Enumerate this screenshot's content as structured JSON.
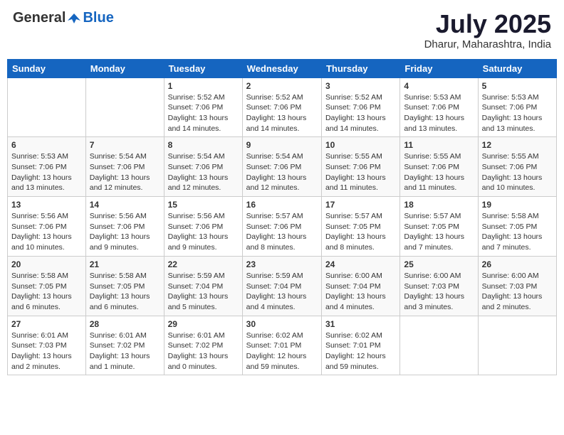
{
  "header": {
    "logo_general": "General",
    "logo_blue": "Blue",
    "month_title": "July 2025",
    "location": "Dharur, Maharashtra, India"
  },
  "days_of_week": [
    "Sunday",
    "Monday",
    "Tuesday",
    "Wednesday",
    "Thursday",
    "Friday",
    "Saturday"
  ],
  "weeks": [
    [
      {
        "day": "",
        "info": ""
      },
      {
        "day": "",
        "info": ""
      },
      {
        "day": "1",
        "info": "Sunrise: 5:52 AM\nSunset: 7:06 PM\nDaylight: 13 hours\nand 14 minutes."
      },
      {
        "day": "2",
        "info": "Sunrise: 5:52 AM\nSunset: 7:06 PM\nDaylight: 13 hours\nand 14 minutes."
      },
      {
        "day": "3",
        "info": "Sunrise: 5:52 AM\nSunset: 7:06 PM\nDaylight: 13 hours\nand 14 minutes."
      },
      {
        "day": "4",
        "info": "Sunrise: 5:53 AM\nSunset: 7:06 PM\nDaylight: 13 hours\nand 13 minutes."
      },
      {
        "day": "5",
        "info": "Sunrise: 5:53 AM\nSunset: 7:06 PM\nDaylight: 13 hours\nand 13 minutes."
      }
    ],
    [
      {
        "day": "6",
        "info": "Sunrise: 5:53 AM\nSunset: 7:06 PM\nDaylight: 13 hours\nand 13 minutes."
      },
      {
        "day": "7",
        "info": "Sunrise: 5:54 AM\nSunset: 7:06 PM\nDaylight: 13 hours\nand 12 minutes."
      },
      {
        "day": "8",
        "info": "Sunrise: 5:54 AM\nSunset: 7:06 PM\nDaylight: 13 hours\nand 12 minutes."
      },
      {
        "day": "9",
        "info": "Sunrise: 5:54 AM\nSunset: 7:06 PM\nDaylight: 13 hours\nand 12 minutes."
      },
      {
        "day": "10",
        "info": "Sunrise: 5:55 AM\nSunset: 7:06 PM\nDaylight: 13 hours\nand 11 minutes."
      },
      {
        "day": "11",
        "info": "Sunrise: 5:55 AM\nSunset: 7:06 PM\nDaylight: 13 hours\nand 11 minutes."
      },
      {
        "day": "12",
        "info": "Sunrise: 5:55 AM\nSunset: 7:06 PM\nDaylight: 13 hours\nand 10 minutes."
      }
    ],
    [
      {
        "day": "13",
        "info": "Sunrise: 5:56 AM\nSunset: 7:06 PM\nDaylight: 13 hours\nand 10 minutes."
      },
      {
        "day": "14",
        "info": "Sunrise: 5:56 AM\nSunset: 7:06 PM\nDaylight: 13 hours\nand 9 minutes."
      },
      {
        "day": "15",
        "info": "Sunrise: 5:56 AM\nSunset: 7:06 PM\nDaylight: 13 hours\nand 9 minutes."
      },
      {
        "day": "16",
        "info": "Sunrise: 5:57 AM\nSunset: 7:06 PM\nDaylight: 13 hours\nand 8 minutes."
      },
      {
        "day": "17",
        "info": "Sunrise: 5:57 AM\nSunset: 7:05 PM\nDaylight: 13 hours\nand 8 minutes."
      },
      {
        "day": "18",
        "info": "Sunrise: 5:57 AM\nSunset: 7:05 PM\nDaylight: 13 hours\nand 7 minutes."
      },
      {
        "day": "19",
        "info": "Sunrise: 5:58 AM\nSunset: 7:05 PM\nDaylight: 13 hours\nand 7 minutes."
      }
    ],
    [
      {
        "day": "20",
        "info": "Sunrise: 5:58 AM\nSunset: 7:05 PM\nDaylight: 13 hours\nand 6 minutes."
      },
      {
        "day": "21",
        "info": "Sunrise: 5:58 AM\nSunset: 7:05 PM\nDaylight: 13 hours\nand 6 minutes."
      },
      {
        "day": "22",
        "info": "Sunrise: 5:59 AM\nSunset: 7:04 PM\nDaylight: 13 hours\nand 5 minutes."
      },
      {
        "day": "23",
        "info": "Sunrise: 5:59 AM\nSunset: 7:04 PM\nDaylight: 13 hours\nand 4 minutes."
      },
      {
        "day": "24",
        "info": "Sunrise: 6:00 AM\nSunset: 7:04 PM\nDaylight: 13 hours\nand 4 minutes."
      },
      {
        "day": "25",
        "info": "Sunrise: 6:00 AM\nSunset: 7:03 PM\nDaylight: 13 hours\nand 3 minutes."
      },
      {
        "day": "26",
        "info": "Sunrise: 6:00 AM\nSunset: 7:03 PM\nDaylight: 13 hours\nand 2 minutes."
      }
    ],
    [
      {
        "day": "27",
        "info": "Sunrise: 6:01 AM\nSunset: 7:03 PM\nDaylight: 13 hours\nand 2 minutes."
      },
      {
        "day": "28",
        "info": "Sunrise: 6:01 AM\nSunset: 7:02 PM\nDaylight: 13 hours\nand 1 minute."
      },
      {
        "day": "29",
        "info": "Sunrise: 6:01 AM\nSunset: 7:02 PM\nDaylight: 13 hours\nand 0 minutes."
      },
      {
        "day": "30",
        "info": "Sunrise: 6:02 AM\nSunset: 7:01 PM\nDaylight: 12 hours\nand 59 minutes."
      },
      {
        "day": "31",
        "info": "Sunrise: 6:02 AM\nSunset: 7:01 PM\nDaylight: 12 hours\nand 59 minutes."
      },
      {
        "day": "",
        "info": ""
      },
      {
        "day": "",
        "info": ""
      }
    ]
  ]
}
